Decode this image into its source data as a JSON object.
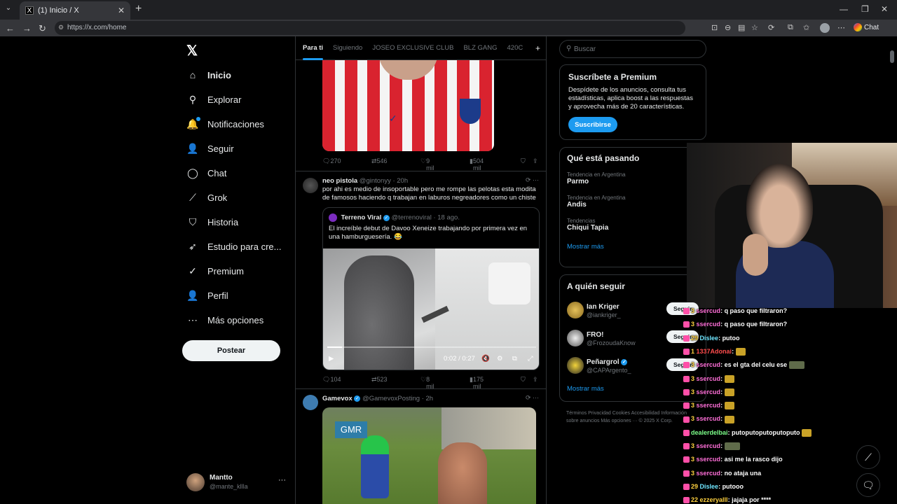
{
  "browser": {
    "tab_title": "(1) Inicio / X",
    "url": "https://x.com/home",
    "chat_label": "Chat"
  },
  "nav": {
    "items": [
      {
        "label": "Inicio",
        "icon": "home-icon",
        "glyph": "⌂"
      },
      {
        "label": "Explorar",
        "icon": "search-icon",
        "glyph": "⚲"
      },
      {
        "label": "Notificaciones",
        "icon": "bell-icon",
        "glyph": "🔔"
      },
      {
        "label": "Seguir",
        "icon": "follow-icon",
        "glyph": "👤"
      },
      {
        "label": "Chat",
        "icon": "chat-icon",
        "glyph": "◯"
      },
      {
        "label": "Grok",
        "icon": "grok-icon",
        "glyph": "⟋"
      },
      {
        "label": "Historia",
        "icon": "bookmark-icon",
        "glyph": "⛉"
      },
      {
        "label": "Estudio para cre...",
        "icon": "rocket-icon",
        "glyph": "➶"
      },
      {
        "label": "Premium",
        "icon": "premium-icon",
        "glyph": "✓"
      },
      {
        "label": "Perfil",
        "icon": "profile-icon",
        "glyph": "👤"
      },
      {
        "label": "Más opciones",
        "icon": "more-icon",
        "glyph": "⋯"
      }
    ],
    "post_label": "Postear",
    "account": {
      "name": "Mantto",
      "handle": "@mante_kllla"
    }
  },
  "timeline": {
    "tabs": [
      "Para ti",
      "Siguiendo",
      "JOSEO EXCLUSIVE CLUB",
      "BLZ GANG",
      "420C"
    ],
    "tweet1_actions": {
      "replies": "270",
      "reposts": "546",
      "likes": "9 mil",
      "views": "504 mil"
    },
    "tweet2": {
      "name": "neo pistola",
      "handle": "@gintonyy",
      "time": "· 20h",
      "text": "por ahi es medio de insoportable pero me rompe las pelotas esta modita de famosos haciendo q trabajan en laburos negreadores como un chiste",
      "quote": {
        "name": "Terreno Viral",
        "handle": "@terrenoviral",
        "time": "· 18 ago.",
        "text": "El increíble debut de Davoo Xeneize trabajando por primera vez en una hamburguesería. 😂",
        "video_time": "0:02 / 0:27",
        "video_progress": 0.07
      },
      "actions": {
        "replies": "104",
        "reposts": "523",
        "likes": "8 mil",
        "views": "175 mil"
      }
    },
    "tweet3": {
      "name": "Gamevox",
      "handle": "@GamevoxPosting",
      "time": "· 2h",
      "image_label": "GMR"
    }
  },
  "sidebar": {
    "search_placeholder": "Buscar",
    "premium": {
      "title": "Suscríbete a Premium",
      "text": "Despídete de los anuncios, consulta tus estadísticas, aplica boost a las respuestas y aprovecha más de 20 características.",
      "button": "Suscribirse"
    },
    "trends": {
      "title": "Qué está pasando",
      "items": [
        {
          "category": "Tendencia en Argentina",
          "name": "Parmo"
        },
        {
          "category": "Tendencia en Argentina",
          "name": "Andis"
        },
        {
          "category": "Tendencias",
          "name": "Chiqui Tapia"
        }
      ],
      "more": "Mostrar más"
    },
    "who_to_follow": {
      "title": "A quién seguir",
      "items": [
        {
          "name": "Ian Kriger",
          "handle": "@iankriger_",
          "button": "Seguir"
        },
        {
          "name": "FRO!",
          "handle": "@FrozoudaKnow",
          "button": "Seguir"
        },
        {
          "name": "Peñargrol",
          "handle": "@CAPArgento_",
          "button": "Seguir"
        }
      ],
      "more": "Mostrar más"
    },
    "footer": "Términos   Privacidad   Cookies   Accesibilidad   Información sobre anuncios   Más opciones ···   © 2025 X Corp."
  },
  "stream_chat": [
    {
      "user": "ssercud",
      "num": "3",
      "msg": "q paso que filtraron?",
      "color": "u-pink"
    },
    {
      "user": "ssercud",
      "num": "3",
      "msg": "q paso que filtraron?",
      "color": "u-pink"
    },
    {
      "user": "Dislee",
      "num": "29",
      "msg": "putoo",
      "color": "u-cyan"
    },
    {
      "user": "1337Adonai",
      "num": "1",
      "msg": "",
      "color": "u-red"
    },
    {
      "user": "ssercud",
      "num": "3",
      "msg": "es el gta del celu ese",
      "color": "u-pink"
    },
    {
      "user": "ssercud",
      "num": "3",
      "msg": "",
      "color": "u-pink"
    },
    {
      "user": "ssercud",
      "num": "3",
      "msg": "",
      "color": "u-pink"
    },
    {
      "user": "ssercud",
      "num": "3",
      "msg": "",
      "color": "u-pink"
    },
    {
      "user": "ssercud",
      "num": "3",
      "msg": "",
      "color": "u-pink"
    },
    {
      "user": "dealerdelbai",
      "num": "",
      "msg": "putoputoputoputoputo",
      "color": "u-green"
    },
    {
      "user": "ssercud",
      "num": "3",
      "msg": "",
      "color": "u-pink"
    },
    {
      "user": "ssercud",
      "num": "3",
      "msg": "asi me la rasco dijo",
      "color": "u-pink"
    },
    {
      "user": "ssercud",
      "num": "3",
      "msg": "no ataja una",
      "color": "u-pink"
    },
    {
      "user": "Dislee",
      "num": "29",
      "msg": "putooo",
      "color": "u-cyan"
    },
    {
      "user": "ezzeryalll",
      "num": "22",
      "msg": "jajaja por ****",
      "color": "u-gold"
    }
  ]
}
